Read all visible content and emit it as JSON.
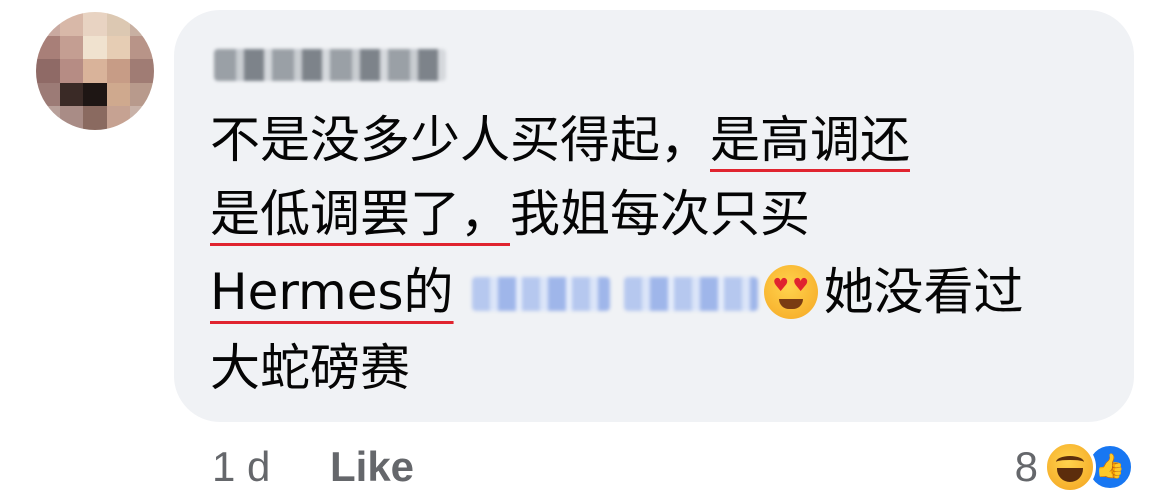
{
  "comment": {
    "author_name": "(blurred)",
    "lines": [
      {
        "plain": "不是没多少人买得起，",
        "underlined": "是高调还"
      },
      {
        "underlined": "是低调罢了，",
        "plain": "我姐每次只买"
      },
      {
        "underlined": "Hermes的",
        "blurred_link": "(blurred)",
        "emoji": "heart-eyes",
        "plain": "她没看过"
      },
      {
        "plain": "大蛇磅赛"
      }
    ]
  },
  "meta": {
    "time": "1 d",
    "like_label": "Like"
  },
  "reactions": {
    "count": "8",
    "types": [
      "haha-icon",
      "like-icon"
    ]
  },
  "colors": {
    "bubble_bg": "#f0f2f5",
    "underline": "#e0242f",
    "meta_text": "#65676b",
    "like_blue": "#1877f2"
  }
}
